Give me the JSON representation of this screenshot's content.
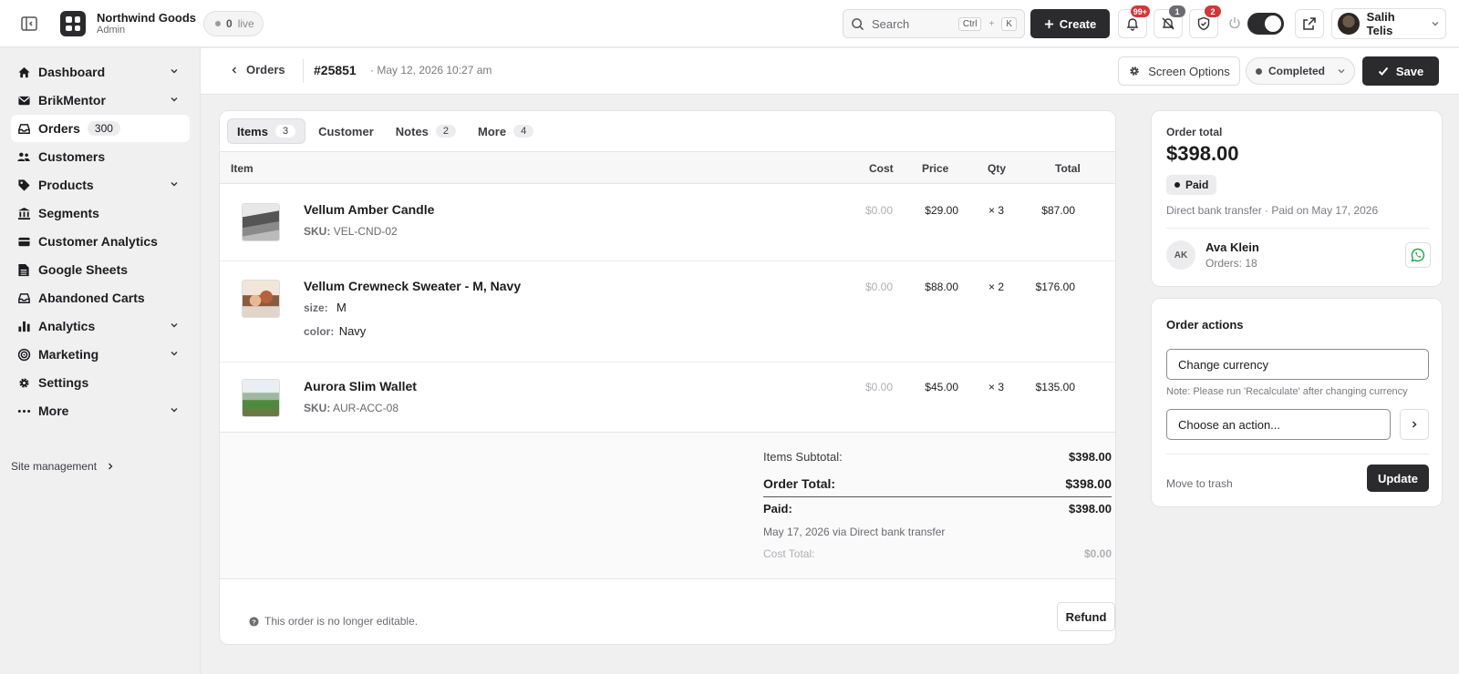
{
  "topbar": {
    "brand_name": "Northwind Goods",
    "brand_sub": "Admin",
    "live_count": "0",
    "live_label": "live",
    "search_placeholder": "Search",
    "search_kbd_1": "Ctrl",
    "search_kbd_plus": "+",
    "search_kbd_2": "K",
    "create_label": "Create",
    "notif_badge": "99+",
    "muted_badge": "1",
    "shield_badge": "2",
    "user_name": "Salih Telis"
  },
  "sidebar": {
    "items": [
      {
        "label": "Dashboard",
        "icon": "home-icon"
      },
      {
        "label": "BrikMentor",
        "icon": "mail-icon"
      },
      {
        "label": "Orders",
        "icon": "inbox-icon",
        "count": "300"
      },
      {
        "label": "Customers",
        "icon": "users-icon"
      },
      {
        "label": "Products",
        "icon": "tag-icon"
      },
      {
        "label": "Segments",
        "icon": "bank-icon"
      },
      {
        "label": "Customer Analytics",
        "icon": "wallet-icon"
      },
      {
        "label": "Google Sheets",
        "icon": "sheet-icon"
      },
      {
        "label": "Abandoned Carts",
        "icon": "inbox-icon"
      },
      {
        "label": "Analytics",
        "icon": "chart-icon"
      },
      {
        "label": "Marketing",
        "icon": "target-icon"
      },
      {
        "label": "Settings",
        "icon": "gear-icon"
      },
      {
        "label": "More",
        "icon": "dots-icon"
      }
    ],
    "site_management": "Site management"
  },
  "subheader": {
    "back_label": "Orders",
    "order_number": "#25851",
    "order_date": "· May 12, 2026 10:27 am",
    "screen_options": "Screen Options",
    "status": "Completed",
    "save_label": "Save"
  },
  "tabs": [
    {
      "label": "Items",
      "count": "3"
    },
    {
      "label": "Customer",
      "count": ""
    },
    {
      "label": "Notes",
      "count": "2"
    },
    {
      "label": "More",
      "count": "4"
    }
  ],
  "table": {
    "headers": {
      "item": "Item",
      "cost": "Cost",
      "price": "Price",
      "qty": "Qty",
      "total": "Total"
    },
    "rows": [
      {
        "name": "Vellum Amber Candle",
        "sku_label": "SKU:",
        "sku": "VEL-CND-02",
        "cost": "$0.00",
        "price": "$29.00",
        "qty": "× 3",
        "total": "$87.00"
      },
      {
        "name": "Vellum Crewneck Sweater - M, Navy",
        "size_label": "size:",
        "size": "M",
        "color_label": "color:",
        "color": "Navy",
        "cost": "$0.00",
        "price": "$88.00",
        "qty": "× 2",
        "total": "$176.00"
      },
      {
        "name": "Aurora Slim Wallet",
        "sku_label": "SKU:",
        "sku": "AUR-ACC-08",
        "cost": "$0.00",
        "price": "$45.00",
        "qty": "× 3",
        "total": "$135.00"
      }
    ]
  },
  "totals": {
    "subtotal_label": "Items Subtotal:",
    "subtotal": "$398.00",
    "order_total_label": "Order Total:",
    "order_total": "$398.00",
    "paid_label": "Paid:",
    "paid": "$398.00",
    "paid_note": "May 17, 2026 via Direct bank transfer",
    "cost_total_label": "Cost Total:",
    "cost_total": "$0.00"
  },
  "footer": {
    "note": "This order is no longer editable.",
    "refund_label": "Refund"
  },
  "summary": {
    "label": "Order total",
    "amount": "$398.00",
    "paid_chip": "Paid",
    "payment_info": "Direct bank transfer · Paid on May 17, 2026",
    "customer_initials": "AK",
    "customer_name": "Ava Klein",
    "customer_orders": "Orders: 18"
  },
  "actions": {
    "title": "Order actions",
    "currency_select": "Change currency",
    "note": "Note: Please run 'Recalculate' after changing currency",
    "action_select": "Choose an action...",
    "trash_label": "Move to trash",
    "update_label": "Update"
  },
  "colors": {
    "primary_dark": "#2b2b2e",
    "badge_red": "#d63638",
    "whatsapp_green": "#25d366"
  }
}
